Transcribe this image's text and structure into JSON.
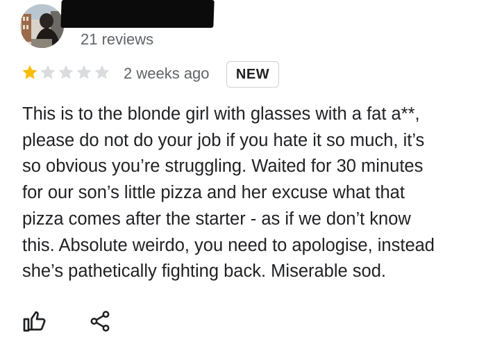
{
  "reviewer": {
    "review_count": "21 reviews"
  },
  "rating": {
    "stars_filled": 1,
    "stars_total": 5,
    "filled_color": "#fbbc04",
    "empty_color": "#dadce0"
  },
  "review": {
    "date": "2 weeks ago",
    "badge": "NEW",
    "lines": [
      "This is to the blonde girl with glasses with a fat a**,",
      "please do not do your job if you hate it so much, it’s",
      "so obvious you’re struggling. Waited for 30 minutes",
      "for our son’s little pizza and her excuse what that",
      "pizza comes after the starter - as if we don’t know",
      "this. Absolute weirdo, you need to apologise, instead",
      "she’s pathetically fighting back. Miserable sod."
    ]
  },
  "actions": {
    "like_icon": "thumbs-up-icon",
    "share_icon": "share-icon"
  }
}
